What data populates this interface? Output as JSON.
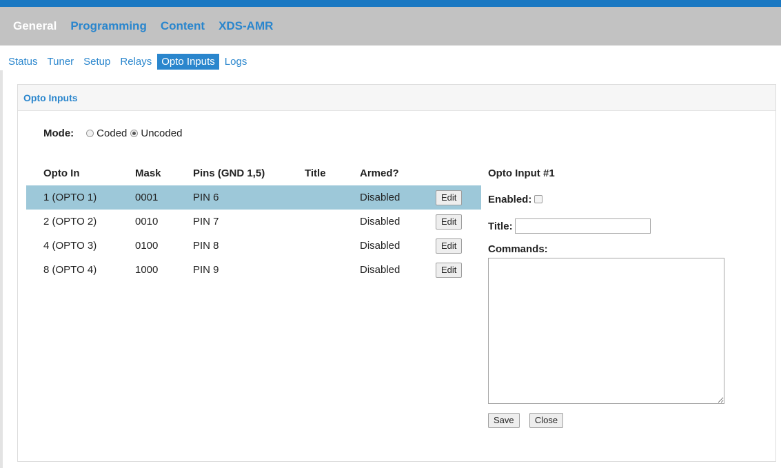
{
  "main_nav": [
    {
      "label": "General",
      "active": true
    },
    {
      "label": "Programming",
      "active": false
    },
    {
      "label": "Content",
      "active": false
    },
    {
      "label": "XDS-AMR",
      "active": false
    }
  ],
  "sub_nav": [
    {
      "label": "Status",
      "active": false
    },
    {
      "label": "Tuner",
      "active": false
    },
    {
      "label": "Setup",
      "active": false
    },
    {
      "label": "Relays",
      "active": false
    },
    {
      "label": "Opto Inputs",
      "active": true
    },
    {
      "label": "Logs",
      "active": false
    }
  ],
  "panel": {
    "title": "Opto Inputs",
    "mode": {
      "label": "Mode:",
      "options": [
        {
          "label": "Coded",
          "checked": false
        },
        {
          "label": "Uncoded",
          "checked": true
        }
      ]
    },
    "table": {
      "headers": [
        "Opto In",
        "Mask",
        "Pins (GND 1,5)",
        "Title",
        "Armed?"
      ],
      "rows": [
        {
          "opto_in": "1 (OPTO 1)",
          "mask": "0001",
          "pins": "PIN 6",
          "title": "",
          "armed": "Disabled",
          "edit": "Edit",
          "selected": true
        },
        {
          "opto_in": "2 (OPTO 2)",
          "mask": "0010",
          "pins": "PIN 7",
          "title": "",
          "armed": "Disabled",
          "edit": "Edit",
          "selected": false
        },
        {
          "opto_in": "4 (OPTO 3)",
          "mask": "0100",
          "pins": "PIN 8",
          "title": "",
          "armed": "Disabled",
          "edit": "Edit",
          "selected": false
        },
        {
          "opto_in": "8 (OPTO 4)",
          "mask": "1000",
          "pins": "PIN 9",
          "title": "",
          "armed": "Disabled",
          "edit": "Edit",
          "selected": false
        }
      ]
    },
    "edit_panel": {
      "title": "Opto Input #1",
      "enabled_label": "Enabled:",
      "enabled": false,
      "title_label": "Title:",
      "title_value": "",
      "commands_label": "Commands:",
      "commands_value": "",
      "save_label": "Save",
      "close_label": "Close"
    }
  },
  "colors": {
    "accent": "#2a86cd",
    "top_stripe": "#1a78c2",
    "nav_background": "#c2c2c2",
    "selected_row": "#9dc8d9"
  }
}
